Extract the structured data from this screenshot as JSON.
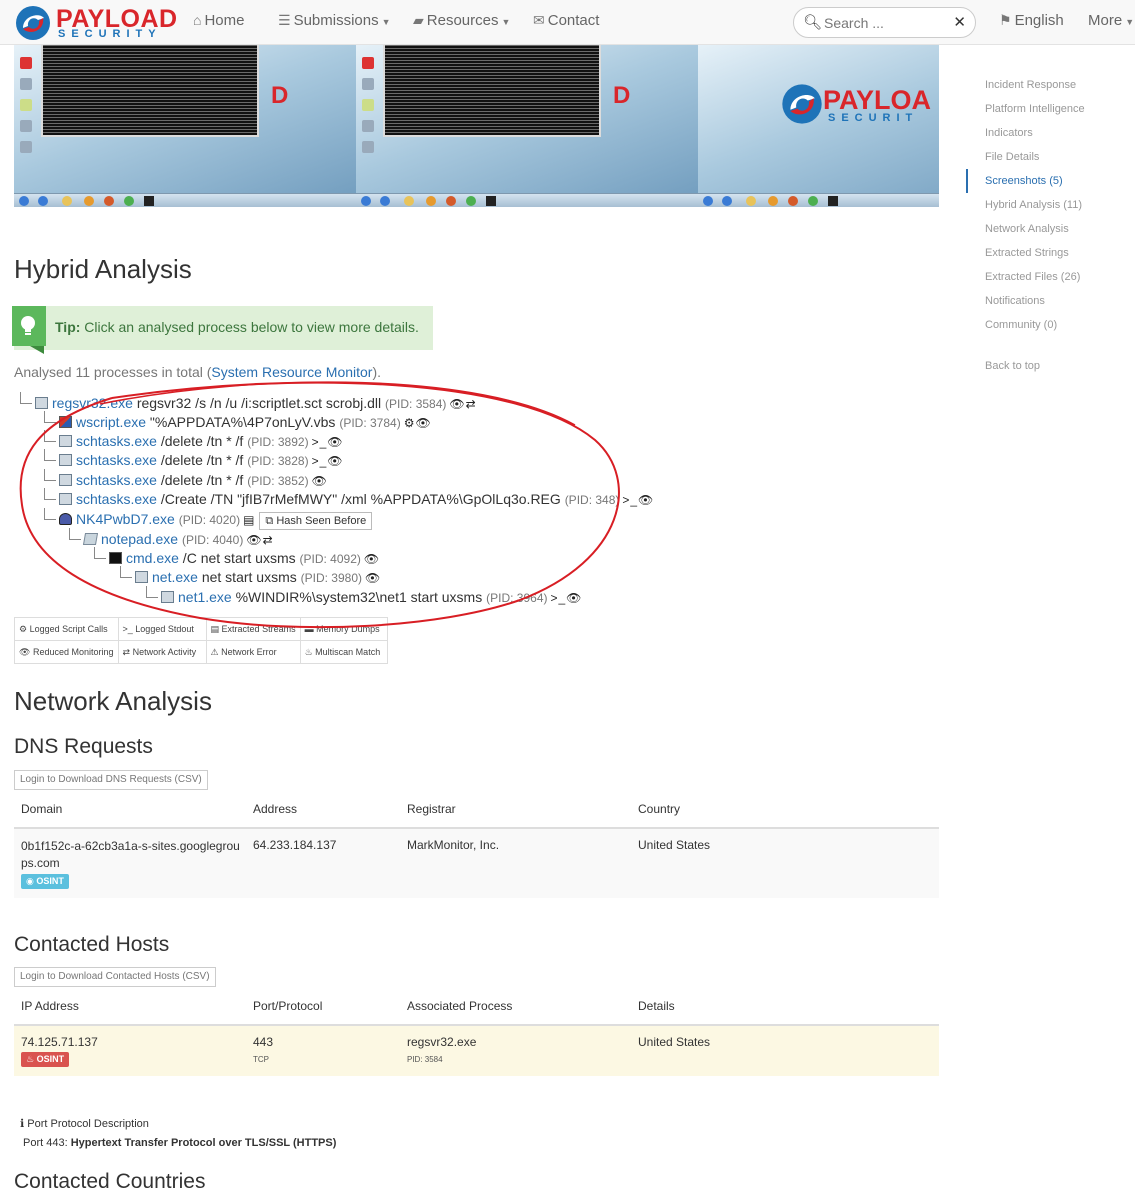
{
  "brand": {
    "name_top": "PAYLOAD",
    "name_bottom": "SECURITY"
  },
  "nav": {
    "home": "Home",
    "submissions": "Submissions",
    "resources": "Resources",
    "contact": "Contact",
    "search_placeholder": "Search ...",
    "language": "English",
    "more": "More"
  },
  "screenshots": {
    "logo_text_top": "PAYLOA",
    "logo_text_bottom": "SECURIT"
  },
  "sidenav": {
    "items": [
      {
        "label": "Incident Response",
        "active": false
      },
      {
        "label": "Platform Intelligence",
        "active": false
      },
      {
        "label": "Indicators",
        "active": false
      },
      {
        "label": "File Details",
        "active": false
      },
      {
        "label": "Screenshots (5)",
        "active": true
      },
      {
        "label": "Hybrid Analysis (11)",
        "active": false
      },
      {
        "label": "Network Analysis",
        "active": false
      },
      {
        "label": "Extracted Strings",
        "active": false
      },
      {
        "label": "Extracted Files (26)",
        "active": false
      },
      {
        "label": "Notifications",
        "active": false
      },
      {
        "label": "Community (0)",
        "active": false
      }
    ],
    "back_to_top": "Back to top"
  },
  "hybrid": {
    "title": "Hybrid Analysis",
    "tip_label": "Tip:",
    "tip_text": " Click an analysed process below to view more details.",
    "analysed_prefix": "Analysed 11 processes in total (",
    "analysed_link": "System Resource Monitor",
    "analysed_suffix": ").",
    "processes": [
      {
        "name": "regsvr32.exe",
        "args": " regsvr32 /s /n /u /i:scriptlet.sct scrobj.dll",
        "pid": "(PID: 3584)",
        "acts": "👁⇄",
        "icon": "plain"
      },
      {
        "name": "wscript.exe",
        "args": " \"%APPDATA%\\4P7onLyV.vbs",
        "pid": "(PID: 3784)",
        "acts": "⚙👁",
        "icon": "script"
      },
      {
        "name": "schtasks.exe",
        "args": " /delete /tn * /f",
        "pid": "(PID: 3892)",
        "acts": ">_👁",
        "icon": "plain"
      },
      {
        "name": "schtasks.exe",
        "args": " /delete /tn * /f",
        "pid": "(PID: 3828)",
        "acts": ">_👁",
        "icon": "plain"
      },
      {
        "name": "schtasks.exe",
        "args": " /delete /tn * /f",
        "pid": "(PID: 3852)",
        "acts": "👁",
        "icon": "plain"
      },
      {
        "name": "schtasks.exe",
        "args": " /Create /TN \"jfIB7rMefMWY\" /xml %APPDATA%\\GpOlLq3o.REG",
        "pid": "(PID: 348)",
        "acts": ">_👁",
        "icon": "plain"
      },
      {
        "name": "NK4PwbD7.exe",
        "args": "",
        "pid": "(PID: 4020)",
        "acts": "▤",
        "icon": "user",
        "hash_button": "Hash Seen Before"
      },
      {
        "name": "notepad.exe",
        "args": "",
        "pid": "(PID: 4040)",
        "acts": "👁⇄",
        "icon": "note"
      },
      {
        "name": "cmd.exe",
        "args": " /C net start uxsms",
        "pid": "(PID: 4092)",
        "acts": "👁",
        "icon": "cmd"
      },
      {
        "name": "net.exe",
        "args": " net start uxsms",
        "pid": "(PID: 3980)",
        "acts": "👁",
        "icon": "plain"
      },
      {
        "name": "net1.exe",
        "args": " %WINDIR%\\system32\\net1 start uxsms",
        "pid": "(PID: 3964)",
        "acts": ">_👁",
        "icon": "plain"
      }
    ],
    "legend": [
      [
        "Logged Script Calls",
        "Logged Stdout",
        "Extracted Streams",
        "Memory Dumps"
      ],
      [
        "Reduced Monitoring",
        "Network Activity",
        "Network Error",
        "Multiscan Match"
      ]
    ],
    "legend_icons": [
      [
        "⚙",
        ">_",
        "▤",
        "▬"
      ],
      [
        "👁",
        "⇄",
        "⚠",
        "♨"
      ]
    ]
  },
  "network": {
    "title": "Network Analysis",
    "dns": {
      "title": "DNS Requests",
      "download": "Login to Download DNS Requests (CSV)",
      "headers": [
        "Domain",
        "Address",
        "Registrar",
        "Country"
      ],
      "rows": [
        {
          "domain_1": "0b1f152c-a-62cb3a1a-s-sites.googlegrou",
          "domain_2": "ps.com",
          "badge": "OSINT",
          "address": "64.233.184.137",
          "registrar": "MarkMonitor, Inc.",
          "country": "United States"
        }
      ]
    },
    "hosts": {
      "title": "Contacted Hosts",
      "download": "Login to Download Contacted Hosts (CSV)",
      "headers": [
        "IP Address",
        "Port/Protocol",
        "Associated Process",
        "Details"
      ],
      "rows": [
        {
          "ip": "74.125.71.137",
          "badge": "OSINT",
          "port": "443",
          "protocol": "TCP",
          "process": "regsvr32.exe",
          "pid": "PID: 3584",
          "details": "United States"
        }
      ]
    },
    "port_title": "Port Protocol Description",
    "port_prefix": "Port 443: ",
    "port_desc": "Hypertext Transfer Protocol over TLS/SSL (HTTPS)",
    "countries_title": "Contacted Countries"
  },
  "colors": {
    "brand_red": "#d9262b",
    "brand_blue": "#1e73b8",
    "link": "#2a6fb0",
    "tip_bg": "#dff0d8",
    "highlight_row": "#fcf8e3"
  }
}
